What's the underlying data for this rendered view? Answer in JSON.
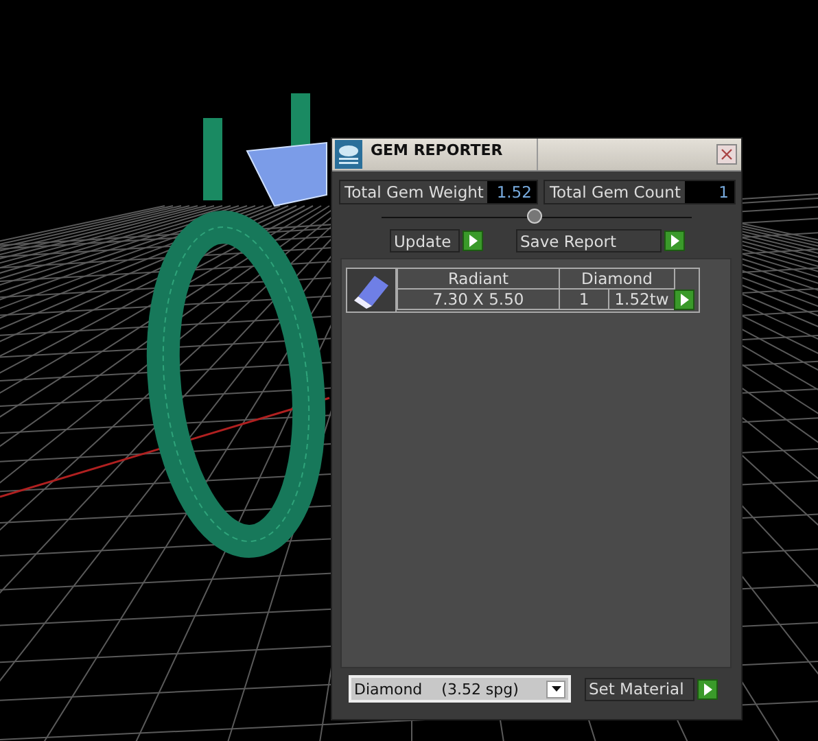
{
  "window": {
    "title": "GEM REPORTER"
  },
  "totals": [
    {
      "label": "Total Gem Weight",
      "value": "1.52"
    },
    {
      "label": "Total Gem Count",
      "value": "1"
    }
  ],
  "buttons": [
    "Update",
    "Save Report"
  ],
  "gems": [
    {
      "shape": "Radiant",
      "material": "Diamond",
      "size": "7.30 X 5.50",
      "count": "1",
      "weight": "1.52tw"
    }
  ],
  "material_select": {
    "value": "Diamond    (3.52 spg)"
  },
  "material_button": "Set Material"
}
